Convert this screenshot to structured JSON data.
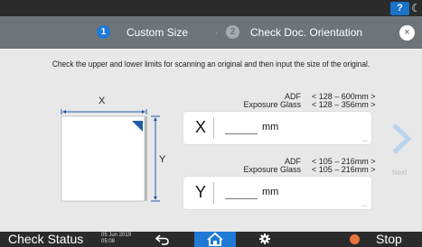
{
  "topbar": {
    "help_label": "?"
  },
  "header": {
    "steps": [
      {
        "num": "1",
        "label": "Custom Size"
      },
      {
        "num": "2",
        "label": "Check Doc. Orientation"
      }
    ],
    "close_label": "×"
  },
  "instruction": "Check the upper and lower limits for scanning an original and then input the size of the original.",
  "diagram": {
    "x_label": "X",
    "y_label": "Y"
  },
  "x_field": {
    "adf_label": "ADF",
    "adf_range": "< 128 – 600mm >",
    "glass_label": "Exposure Glass",
    "glass_range": "< 128 – 356mm >",
    "letter": "X",
    "value": "",
    "unit": "mm",
    "more": "..."
  },
  "y_field": {
    "adf_label": "ADF",
    "adf_range": "< 105 – 216mm >",
    "glass_label": "Exposure Glass",
    "glass_range": "< 105 – 216mm >",
    "letter": "Y",
    "value": "",
    "unit": "mm",
    "more": "..."
  },
  "next_label": "Next",
  "bottombar": {
    "check_status": "Check Status",
    "date": "05 Jun 2019",
    "time": "05:08",
    "stop_label": "Stop"
  },
  "colors": {
    "accent": "#1f7ad6",
    "header_bg": "#6f7479",
    "bar_bg": "#2b2b2b",
    "stop": "#e8743a"
  }
}
